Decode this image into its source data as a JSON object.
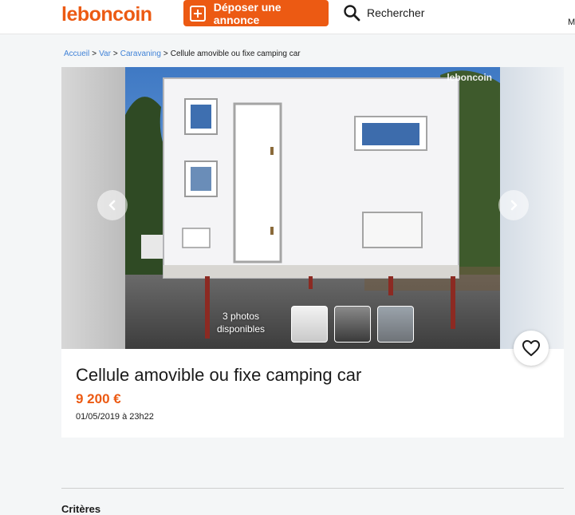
{
  "header": {
    "logo": "leboncoin",
    "post_ad_label": "Déposer une annonce",
    "search_label": "Rechercher",
    "account_initial": "M"
  },
  "breadcrumb": {
    "items": [
      "Accueil",
      "Var",
      "Caravaning"
    ],
    "separator": ">",
    "current": "Cellule amovible ou fixe camping car"
  },
  "gallery": {
    "watermark": "leboncoin",
    "photo_count_line1": "3 photos",
    "photo_count_line2": "disponibles",
    "thumbnails": 3
  },
  "ad": {
    "title": "Cellule amovible ou fixe camping car",
    "price": "9 200 €",
    "date": "01/05/2019 à 23h22"
  },
  "sections": {
    "criteria_title": "Critères"
  },
  "colors": {
    "brand": "#ec5a13",
    "link": "#4183d7"
  },
  "icons": [
    "plus-icon",
    "search-icon",
    "chevron-left-icon",
    "chevron-right-icon",
    "heart-icon"
  ]
}
